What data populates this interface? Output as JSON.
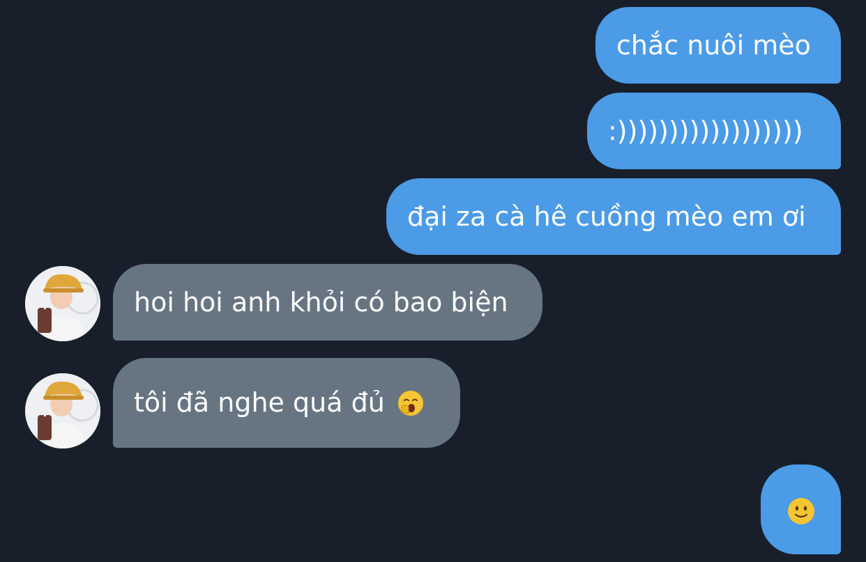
{
  "messages": [
    {
      "side": "sent",
      "text": "chắc nuôi mèo"
    },
    {
      "side": "sent",
      "text": ":))))))))))))))))))"
    },
    {
      "side": "sent",
      "text": "đại za cà hê cuồng mèo em ơi"
    },
    {
      "side": "received",
      "text": "hoi hoi anh khỏi có bao biện"
    },
    {
      "side": "received",
      "text": "tôi đã nghe quá đủ",
      "emoji": "yawning-face-icon"
    },
    {
      "side": "sent",
      "text": "",
      "emoji": "slightly-smiling-face-icon"
    }
  ],
  "colors": {
    "background": "#181f2a",
    "sent_bubble": "#4b9be7",
    "received_bubble": "#677582",
    "text": "#ffffff"
  }
}
